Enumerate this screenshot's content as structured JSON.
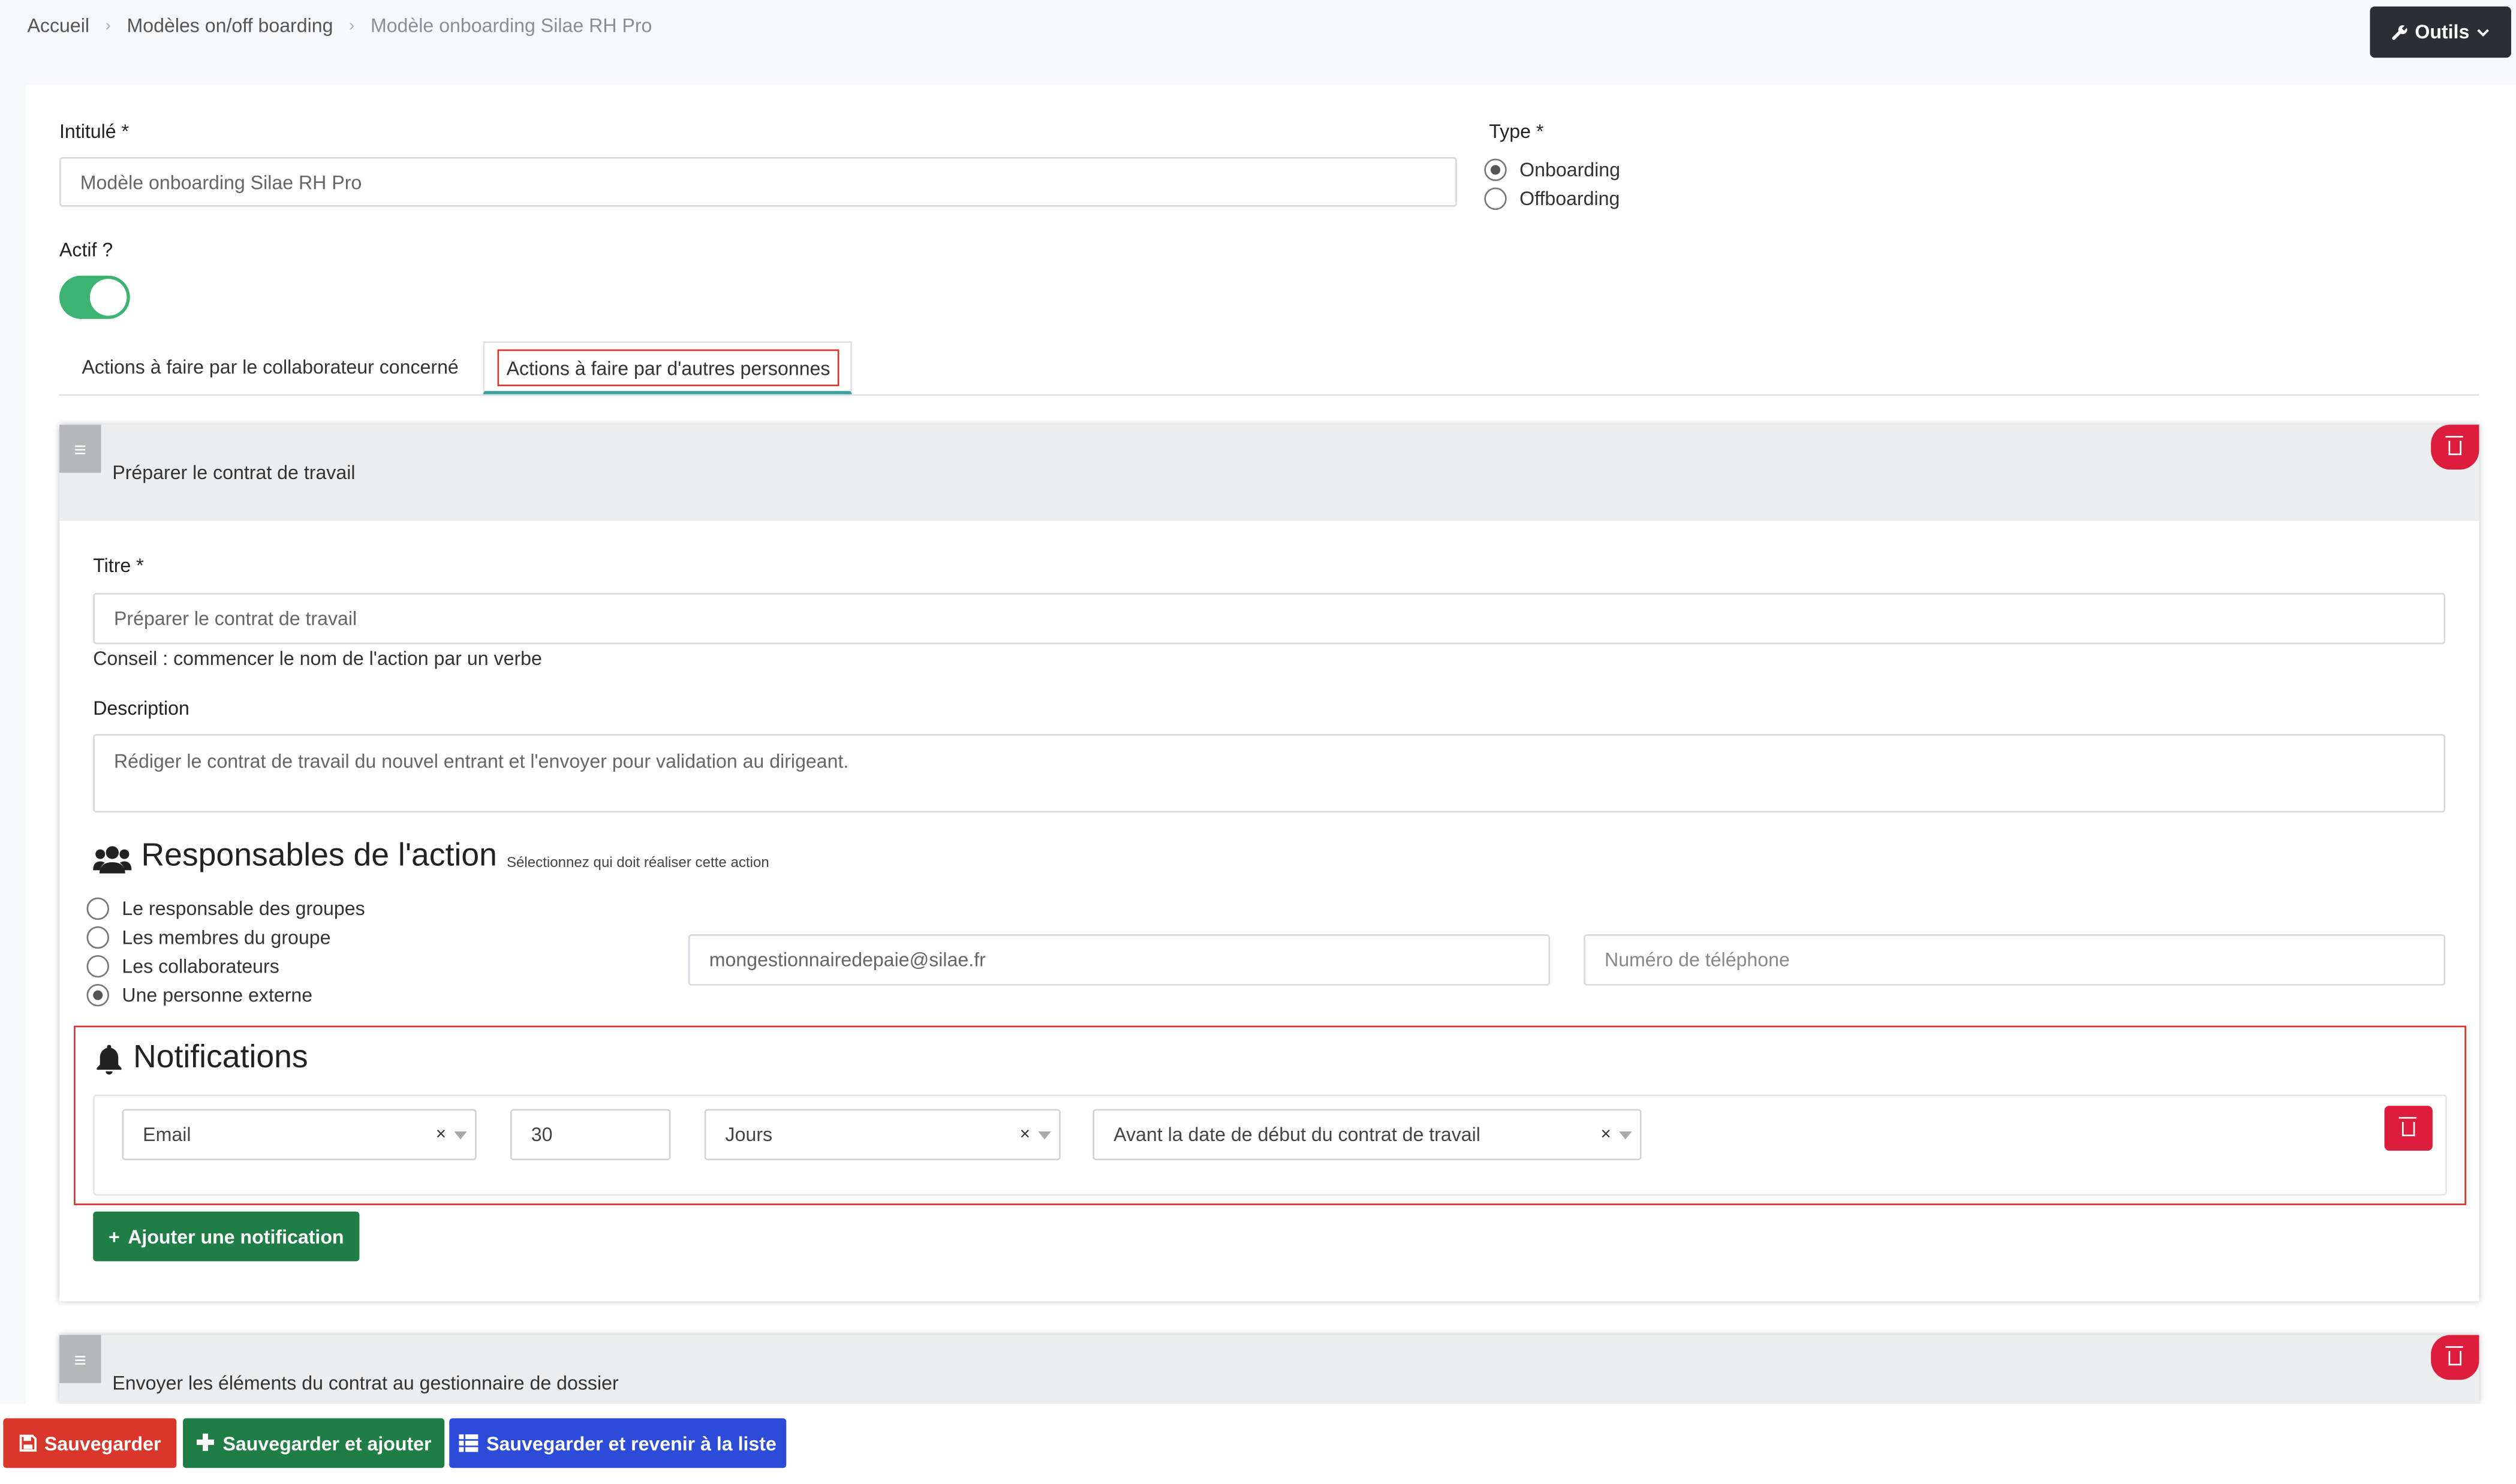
{
  "breadcrumb": {
    "items": [
      "Accueil",
      "Modèles on/off boarding"
    ],
    "current": "Modèle onboarding Silae RH Pro",
    "separator": "›"
  },
  "tools_button": {
    "label": "Outils",
    "icon": "wrench-icon",
    "caret": "chevron-down-icon"
  },
  "form": {
    "intitule_label": "Intitulé *",
    "intitule_value": "Modèle onboarding Silae RH Pro",
    "type_label": "Type *",
    "type_options": [
      {
        "label": "Onboarding",
        "selected": true
      },
      {
        "label": "Offboarding",
        "selected": false
      }
    ],
    "actif_label": "Actif ?",
    "actif_on": true
  },
  "tabs": [
    {
      "label": "Actions à faire par le collaborateur concerné",
      "active": false
    },
    {
      "label": "Actions à faire par d'autres personnes",
      "active": true
    }
  ],
  "action1": {
    "header": "Préparer le contrat de travail",
    "titre_label": "Titre *",
    "titre_value": "Préparer le contrat de travail",
    "titre_hint": "Conseil : commencer le nom de l'action par un verbe",
    "description_label": "Description",
    "description_value": "Rédiger le contrat de travail du nouvel entrant et l'envoyer pour validation au dirigeant.",
    "responsables_title": "Responsables de l'action",
    "responsables_subtitle": "Sélectionnez qui doit réaliser cette action",
    "responsables_options": [
      {
        "label": "Le responsable des groupes",
        "selected": false
      },
      {
        "label": "Les membres du groupe",
        "selected": false
      },
      {
        "label": "Les collaborateurs",
        "selected": false
      },
      {
        "label": "Une personne externe",
        "selected": true
      }
    ],
    "email_value": "mongestionnairedepaie@silae.fr",
    "phone_placeholder": "Numéro de téléphone",
    "notifications_title": "Notifications",
    "notification": {
      "channel": "Email",
      "amount": "30",
      "unit": "Jours",
      "reference": "Avant la date de début du contrat de travail",
      "clear": "×"
    },
    "add_notification_label": "Ajouter une notification"
  },
  "action2": {
    "header": "Envoyer les éléments du contrat au gestionnaire de dossier"
  },
  "footer": {
    "save_label": "Sauvegarder",
    "save_add_label": "Sauvegarder et ajouter",
    "save_back_label": "Sauvegarder et revenir à la liste"
  },
  "colors": {
    "toggle": "#3cb371",
    "highlight": "#d9362b",
    "delete": "#dc1e3c",
    "save": "#d9372b",
    "save_add": "#1e7e45",
    "save_back": "#2c4bd8",
    "add_notification": "#1e7e45"
  }
}
